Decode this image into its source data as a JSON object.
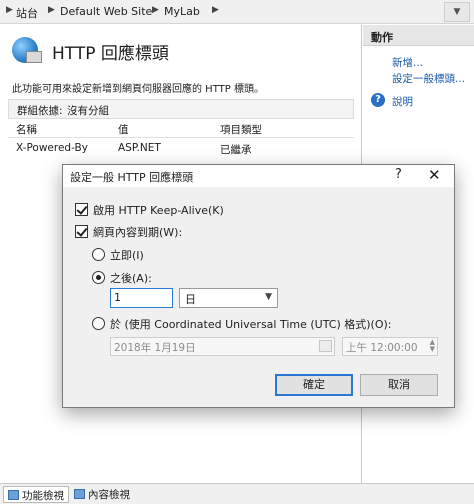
{
  "breadcrumb": {
    "items": [
      "站台",
      "Default Web Site",
      "MyLab"
    ]
  },
  "main": {
    "title": "HTTP 回應標頭",
    "description": "此功能可用來設定新增到網頁伺服器回應的 HTTP 標頭。",
    "group_label": "群組依據:",
    "group_value": "沒有分組",
    "columns": [
      "名稱",
      "值",
      "項目類型"
    ],
    "rows": [
      {
        "name": "X-Powered-By",
        "value": "ASP.NET",
        "type": "已繼承"
      }
    ]
  },
  "actions": {
    "header": "動作",
    "items": [
      "新增...",
      "設定一般標頭..."
    ],
    "help": "說明"
  },
  "bottom_tabs": [
    "功能檢視",
    "內容檢視"
  ],
  "dialog": {
    "title": "設定一般 HTTP 回應標頭",
    "help_glyph": "?",
    "close_glyph": "✕",
    "keepalive_label": "啟用 HTTP Keep-Alive(K)",
    "keepalive_checked": true,
    "expire_label": "網頁內容到期(W):",
    "expire_checked": true,
    "immediate_label": "立即(I)",
    "after_label": "之後(A):",
    "after_selected": true,
    "after_value": "1",
    "unit_value": "日",
    "on_label": "於 (使用 Coordinated Universal Time (UTC) 格式)(O):",
    "date_value": "2018年  1月19日",
    "time_value": "上午 12:00:00",
    "ok_label": "確定",
    "cancel_label": "取消"
  },
  "colors": {
    "accent": "#2b78d4",
    "link": "#1a5aa8"
  }
}
